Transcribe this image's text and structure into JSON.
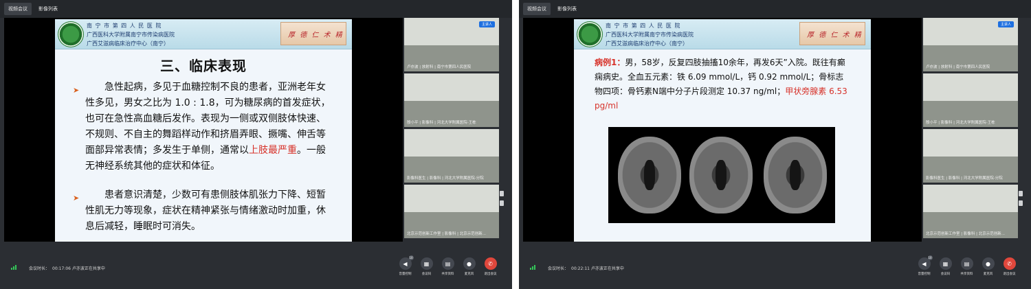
{
  "left": {
    "tabs": [
      "视频会议",
      "影像列表"
    ],
    "hospital": {
      "line1": "南 宁 市 第 四 人 民 医 院",
      "line2": "广西医科大学附属南宁市传染病医院",
      "line3": "广西艾滋病临床治疗中心（南宁）",
      "banner": "厚 德 仁 术 精"
    },
    "slide_title": "三、临床表现",
    "para1_a": "急性起病，多见于血糖控制不良的患者，亚洲老年女性多见，男女之比为 1.0 : 1.8，可为糖尿病的首发症状，也可在急性高血糖后发作。表现为一侧或双侧肢体快速、不规则、不自主的舞蹈样动作和挤眉弄眼、撅嘴、伸舌等面部异常表情；多发生于单侧，通常以",
    "para1_red": "上肢最严重",
    "para1_b": "。一般无神经系统其他的症状和体征。",
    "para2": "患者意识清楚，少数可有患侧肢体肌张力下降、短暂性肌无力等现象，症状在精神紧张与情绪激动时加重，休息后减轻，睡眠时可消失。",
    "videos": [
      {
        "caption": "卢亦波 | 放射科 | 南宁市第四人民医院",
        "badge": "主讲人"
      },
      {
        "caption": "殷小平 | 影像科 | 河北大学附属医院-王栋"
      },
      {
        "caption": "影像科医生 | 影像科 | 河北大学附属医院-分院"
      },
      {
        "caption": "北京示范创新工作室 | 影像科 | 北京示范创新..."
      }
    ],
    "status": {
      "label": "会议时长：",
      "time": "00:17:06",
      "sharing": "卢亦波正在共享中"
    }
  },
  "right": {
    "tabs": [
      "视频会议",
      "影像列表"
    ],
    "case_label": "病例1：",
    "case_a": "男，58岁，反复四肢抽搐10余年，再发6天”入院。既往有癫痫病史。全血五元素：铁 6.09 mmol/L，钙 0.92 mmol/L；骨标志物四项：骨钙素N端中分子片段测定 10.37 ng/ml；",
    "case_red": "甲状旁腺素 6.53 pg/ml",
    "status": {
      "label": "会议时长：",
      "time": "00:22:11",
      "sharing": "卢亦波正在共享中"
    }
  },
  "controls": [
    {
      "label": "音量控制",
      "icon": "speaker-icon",
      "glyph": "◀",
      "badge": "10"
    },
    {
      "label": "会议码",
      "icon": "qrcode-icon",
      "glyph": "▦"
    },
    {
      "label": "共享资料",
      "icon": "document-icon",
      "glyph": "▤"
    },
    {
      "label": "麦克风",
      "icon": "microphone-icon",
      "glyph": "●"
    },
    {
      "label": "退出会议",
      "icon": "hangup-icon",
      "glyph": "✆"
    }
  ],
  "colors": {
    "accent_red": "#d7322a",
    "end_call": "#e0473c",
    "host_badge": "#1d6fe0",
    "signal": "#34c759"
  }
}
